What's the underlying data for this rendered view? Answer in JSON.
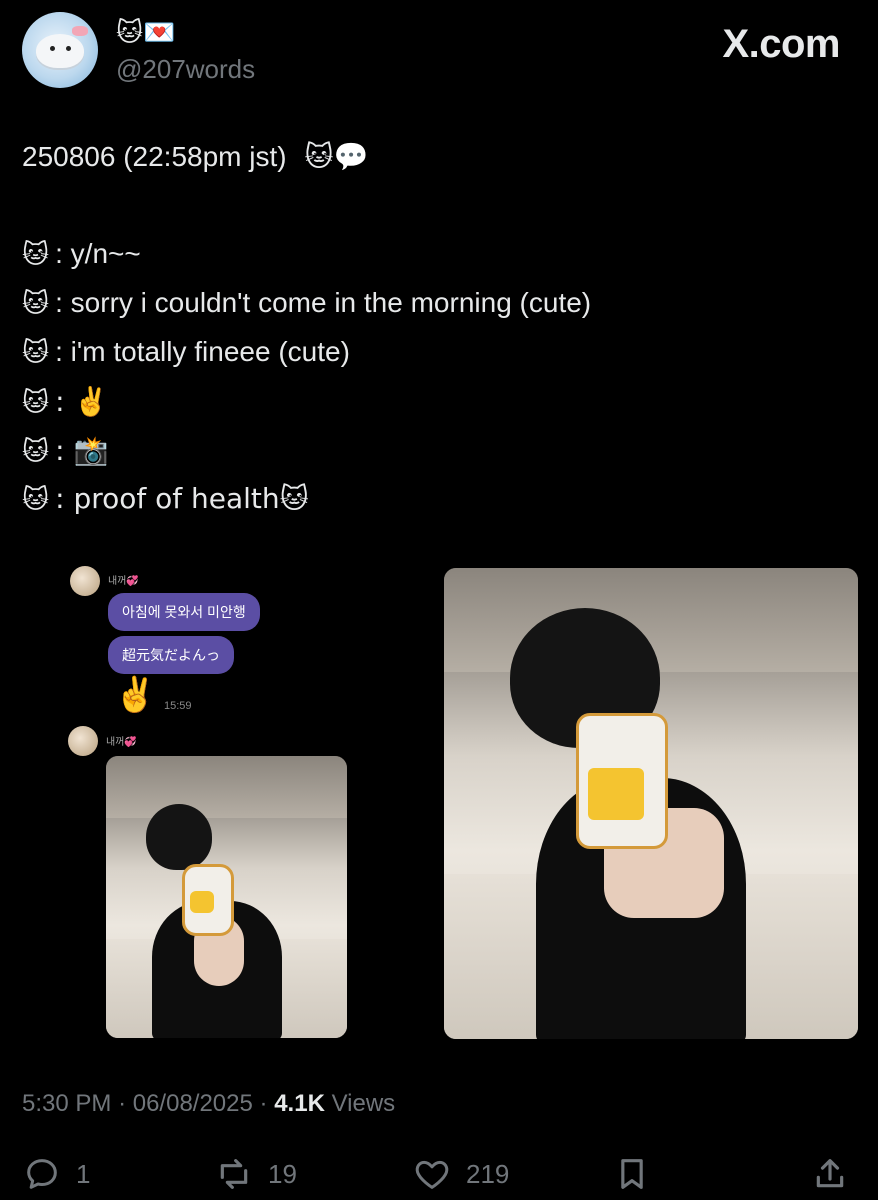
{
  "author": {
    "display_name_emojis": "🐱💌",
    "handle": "@207words"
  },
  "brand": "X.com",
  "tweet": {
    "date_line": "250806 (22:58pm jst)",
    "date_emojis": "🐱💬",
    "lines": [
      {
        "speaker": "🐱",
        "text": ": y/n~~"
      },
      {
        "speaker": "🐱",
        "text": ": sorry i couldn't come in the morning (cute)"
      },
      {
        "speaker": "🐱",
        "text": ": i'm totally fineee (cute)"
      },
      {
        "speaker": "🐱",
        "text": ": ✌️"
      },
      {
        "speaker": "🐱",
        "text": ": 📸"
      },
      {
        "speaker": "🐱",
        "text": ": proof of health🐱"
      }
    ]
  },
  "chat": {
    "sender_name": "내꺼💞",
    "messages": [
      "아침에 못와서 미안행",
      "超元気だよんっ"
    ],
    "peace": "✌️",
    "time": "15:59",
    "sender_name_2": "내꺼💞"
  },
  "meta": {
    "time": "5:30 PM",
    "date": "06/08/2025",
    "views_count": "4.1K",
    "views_label": "Views"
  },
  "actions": {
    "replies": "1",
    "reposts": "19",
    "likes": "219"
  }
}
